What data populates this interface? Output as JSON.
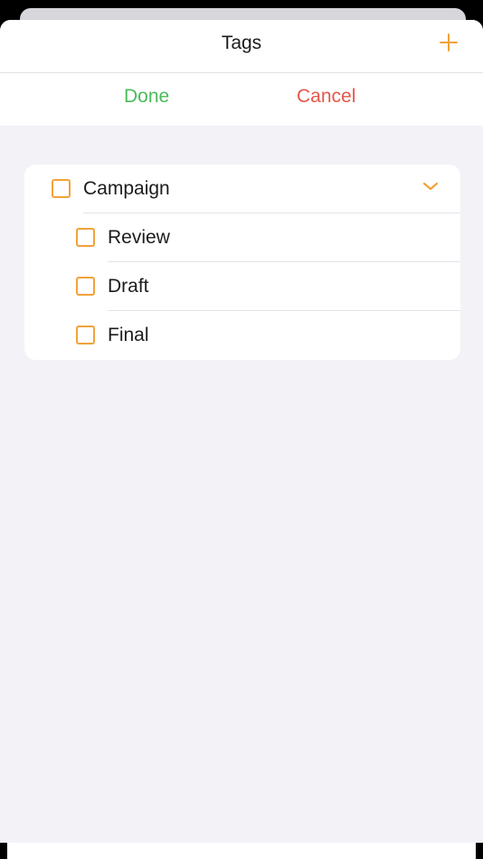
{
  "header": {
    "title": "Tags",
    "add_icon": "plus-icon"
  },
  "actions": {
    "done_label": "Done",
    "cancel_label": "Cancel"
  },
  "tags": {
    "parent": {
      "label": "Campaign",
      "checked": false,
      "expanded": true
    },
    "children": [
      {
        "label": "Review",
        "checked": false
      },
      {
        "label": "Draft",
        "checked": false
      },
      {
        "label": "Final",
        "checked": false
      }
    ]
  },
  "colors": {
    "accent": "#f2a23a",
    "done": "#4cbb5a",
    "cancel": "#e4574a",
    "background": "#f2f2f7"
  }
}
